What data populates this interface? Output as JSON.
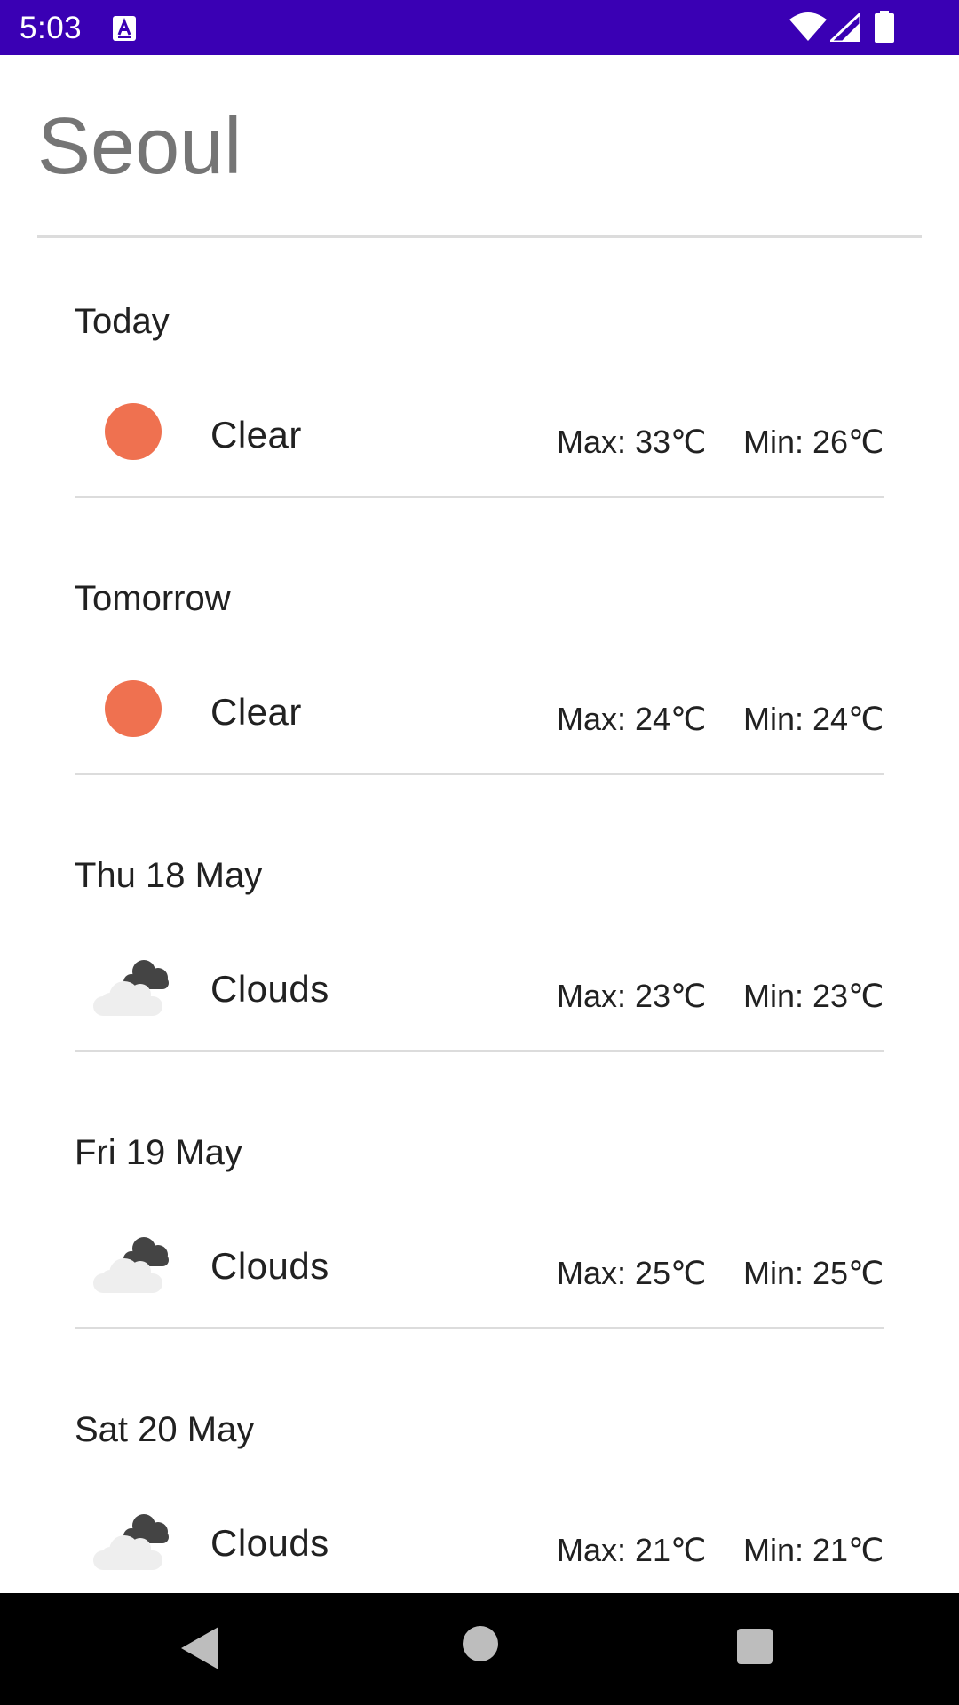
{
  "status_bar": {
    "time": "5:03",
    "icons": [
      "a-icon",
      "wifi-icon",
      "signal-icon",
      "battery-icon"
    ]
  },
  "city": "Seoul",
  "forecast": [
    {
      "day": "Today",
      "condition": "Clear",
      "icon": "sun-icon",
      "max": "Max: 33℃",
      "min": "Min: 26℃"
    },
    {
      "day": "Tomorrow",
      "condition": "Clear",
      "icon": "sun-icon",
      "max": "Max: 24℃",
      "min": "Min: 24℃"
    },
    {
      "day": "Thu 18 May",
      "condition": "Clouds",
      "icon": "clouds-icon",
      "max": "Max: 23℃",
      "min": "Min: 23℃"
    },
    {
      "day": "Fri 19 May",
      "condition": "Clouds",
      "icon": "clouds-icon",
      "max": "Max: 25℃",
      "min": "Min: 25℃"
    },
    {
      "day": "Sat 20 May",
      "condition": "Clouds",
      "icon": "clouds-icon",
      "max": "Max: 21℃",
      "min": "Min: 21℃"
    }
  ],
  "colors": {
    "status_bar": "#3a00b4",
    "sun": "#ef7150",
    "title": "#757575",
    "nav_bar": "#000000"
  },
  "nav": {
    "icons": [
      "back-icon",
      "home-icon",
      "recents-icon"
    ]
  }
}
